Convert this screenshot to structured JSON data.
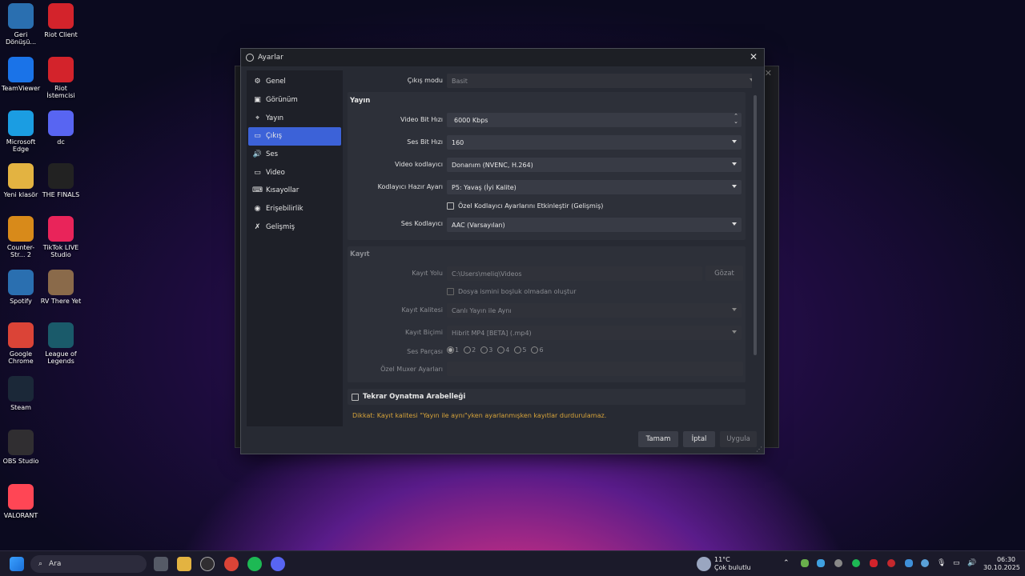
{
  "desktop": {
    "icons": [
      {
        "label": "Geri Dönüşü...",
        "color": "#2a6fb0"
      },
      {
        "label": "Riot Client",
        "color": "#d3232b"
      },
      {
        "label": "TeamViewer",
        "color": "#1a73e8"
      },
      {
        "label": "Riot İstemcisi",
        "color": "#d3232b"
      },
      {
        "label": "Microsoft Edge",
        "color": "#1b9de2"
      },
      {
        "label": "dc",
        "color": "#5865f2"
      },
      {
        "label": "Yeni klasör",
        "color": "#e3b341"
      },
      {
        "label": "THE FINALS",
        "color": "#222222"
      },
      {
        "label": "Counter-Str... 2",
        "color": "#d88a1a"
      },
      {
        "label": "TikTok LIVE Studio",
        "color": "#e9245a"
      },
      {
        "label": "Spotify",
        "color": "#2a6fb0"
      },
      {
        "label": "RV There Yet",
        "color": "#8a6a4a"
      },
      {
        "label": "Google Chrome",
        "color": "#db4437"
      },
      {
        "label": "League of Legends",
        "color": "#1a5a6a"
      },
      {
        "label": "Steam",
        "color": "#1b2838"
      },
      {
        "label": "OBS Studio",
        "color": "#302e31"
      },
      {
        "label": "VALORANT",
        "color": "#ff4655"
      }
    ]
  },
  "dialog": {
    "title": "Ayarlar",
    "close": "✕",
    "nav": [
      {
        "label": "Genel",
        "icon": "⚙"
      },
      {
        "label": "Görünüm",
        "icon": "▣"
      },
      {
        "label": "Yayın",
        "icon": "⌖"
      },
      {
        "label": "Çıkış",
        "icon": "▭"
      },
      {
        "label": "Ses",
        "icon": "🔊"
      },
      {
        "label": "Video",
        "icon": "▭"
      },
      {
        "label": "Kısayollar",
        "icon": "⌨"
      },
      {
        "label": "Erişebilirlik",
        "icon": "◉"
      },
      {
        "label": "Gelişmiş",
        "icon": "✗"
      }
    ],
    "active_nav": "Çıkış",
    "output_mode_label": "Çıkış modu",
    "output_mode_value": "Basit",
    "stream": {
      "title": "Yayın",
      "video_bitrate_label": "Video Bit Hızı",
      "video_bitrate_value": "6000 Kbps",
      "audio_bitrate_label": "Ses Bit Hızı",
      "audio_bitrate_value": "160",
      "video_encoder_label": "Video kodlayıcı",
      "video_encoder_value": "Donanım (NVENC, H.264)",
      "encoder_preset_label": "Kodlayıcı Hazır Ayarı",
      "encoder_preset_value": "P5: Yavaş (İyi Kalite)",
      "custom_encoder_label": "Özel Kodlayıcı Ayarlarını Etkinleştir (Gelişmiş)",
      "audio_encoder_label": "Ses Kodlayıcı",
      "audio_encoder_value": "AAC (Varsayılan)"
    },
    "recording": {
      "title": "Kayıt",
      "path_label": "Kayıt Yolu",
      "path_value": "C:\\Users\\meliq\\Videos",
      "browse_label": "Gözat",
      "no_space_label": "Dosya ismini boşluk olmadan oluştur",
      "quality_label": "Kayıt Kalitesi",
      "quality_value": "Canlı Yayın ile Aynı",
      "format_label": "Kayıt Biçimi",
      "format_value": "Hibrit MP4 [BETA] (.mp4)",
      "audio_track_label": "Ses Parçası",
      "tracks": [
        "1",
        "2",
        "3",
        "4",
        "5",
        "6"
      ],
      "muxer_label": "Özel Muxer Ayarları",
      "muxer_value": ""
    },
    "replay_buffer_label": "Tekrar Oynatma Arabelleği",
    "warning": "Dikkat: Kayıt kalitesi \"Yayın ile aynı\"yken ayarlanmışken kayıtlar durdurulamaz.",
    "buttons": {
      "ok": "Tamam",
      "cancel": "İptal",
      "apply": "Uygula"
    }
  },
  "taskbar": {
    "search_placeholder": "Ara",
    "weather_temp": "11°C",
    "weather_desc": "Çok bulutlu",
    "time": "06:30",
    "date": "30.10.2025"
  }
}
